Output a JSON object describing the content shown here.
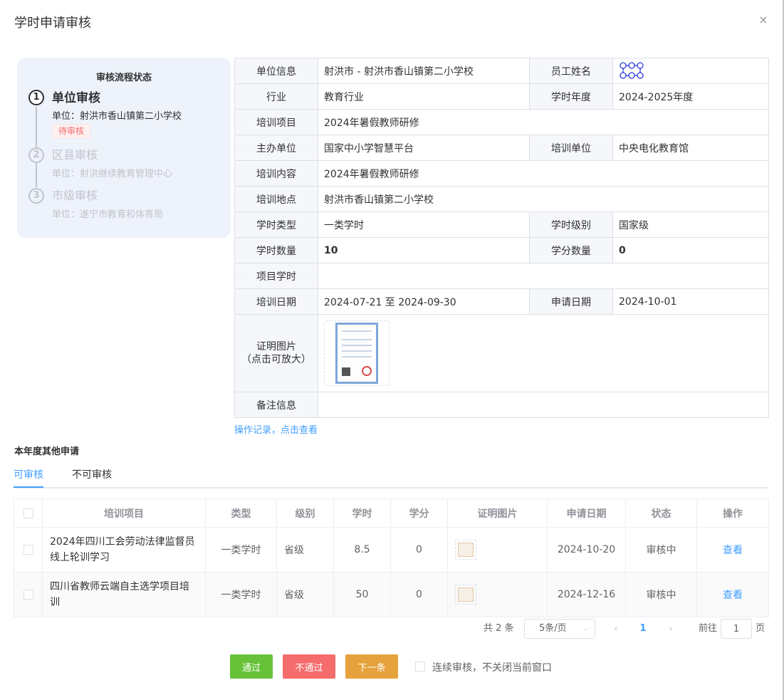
{
  "dialog": {
    "title": "学时申请审核",
    "close_label": "×"
  },
  "status_panel": {
    "title": "审核流程状态",
    "steps": [
      {
        "num": "1",
        "name": "单位审核",
        "unit": "单位：射洪市香山镇第二小学校",
        "tag": "待审核",
        "active": true
      },
      {
        "num": "2",
        "name": "区县审核",
        "unit": "单位：射洪继续教育管理中心",
        "active": false
      },
      {
        "num": "3",
        "name": "市级审核",
        "unit": "单位：遂宁市教育和体育局",
        "active": false
      }
    ]
  },
  "info": {
    "unit_label": "单位信息",
    "unit_value": "射洪市 - 射洪市香山镇第二小学校",
    "employee_label": "员工姓名",
    "industry_label": "行业",
    "industry_value": "教育行业",
    "year_label": "学时年度",
    "year_value": "2024-2025年度",
    "project_label": "培训项目",
    "project_value": "2024年暑假教师研修",
    "host_label": "主办单位",
    "host_value": "国家中小学智慧平台",
    "train_unit_label": "培训单位",
    "train_unit_value": "中央电化教育馆",
    "content_label": "培训内容",
    "content_value": "2024年暑假教师研修",
    "location_label": "培训地点",
    "location_value": "射洪市香山镇第二小学校",
    "hour_type_label": "学时类型",
    "hour_type_value": "一类学时",
    "hour_level_label": "学时级别",
    "hour_level_value": "国家级",
    "hours_label": "学时数量",
    "hours_value": "10",
    "credits_label": "学分数量",
    "credits_value": "0",
    "project_hours_label": "项目学时",
    "project_hours_value": "",
    "date_label": "培训日期",
    "date_value": "2024-07-21 至 2024-09-30",
    "apply_date_label": "申请日期",
    "apply_date_value": "2024-10-01",
    "cert_label_1": "证明图片",
    "cert_label_2": "（点击可放大）",
    "remark_label": "备注信息",
    "remark_value": ""
  },
  "op_record_link": "操作记录，点击查看",
  "others": {
    "section_title": "本年度其他申请",
    "tabs": [
      {
        "label": "可审核",
        "active": true
      },
      {
        "label": "不可审核",
        "active": false
      }
    ],
    "columns": [
      "培训项目",
      "类型",
      "级别",
      "学时",
      "学分",
      "证明图片",
      "申请日期",
      "状态",
      "操作"
    ],
    "rows": [
      {
        "project": "2024年四川工会劳动法律监督员线上轮训学习",
        "type": "一类学时",
        "level": "省级",
        "hours": "8.5",
        "credits": "0",
        "date": "2024-10-20",
        "status": "审核中",
        "action": "查看"
      },
      {
        "project": "四川省教师云端自主选学项目培训",
        "type": "一类学时",
        "level": "省级",
        "hours": "50",
        "credits": "0",
        "date": "2024-12-16",
        "status": "审核中",
        "action": "查看"
      }
    ]
  },
  "pagination": {
    "total": "共 2 条",
    "page_size": "5条/页",
    "prev": "‹",
    "current": "1",
    "next": "›",
    "goto_label": "前往",
    "goto_value": "1",
    "page_unit": "页"
  },
  "footer": {
    "pass": "通过",
    "reject": "不通过",
    "next": "下一条",
    "continuous_label": "连续审核，不关闭当前窗口"
  },
  "colors": {
    "primary": "#409eff",
    "success": "#67c23a",
    "danger": "#f56c6c",
    "warning": "#e6a23c",
    "panel_bg": "#eef2fa"
  }
}
